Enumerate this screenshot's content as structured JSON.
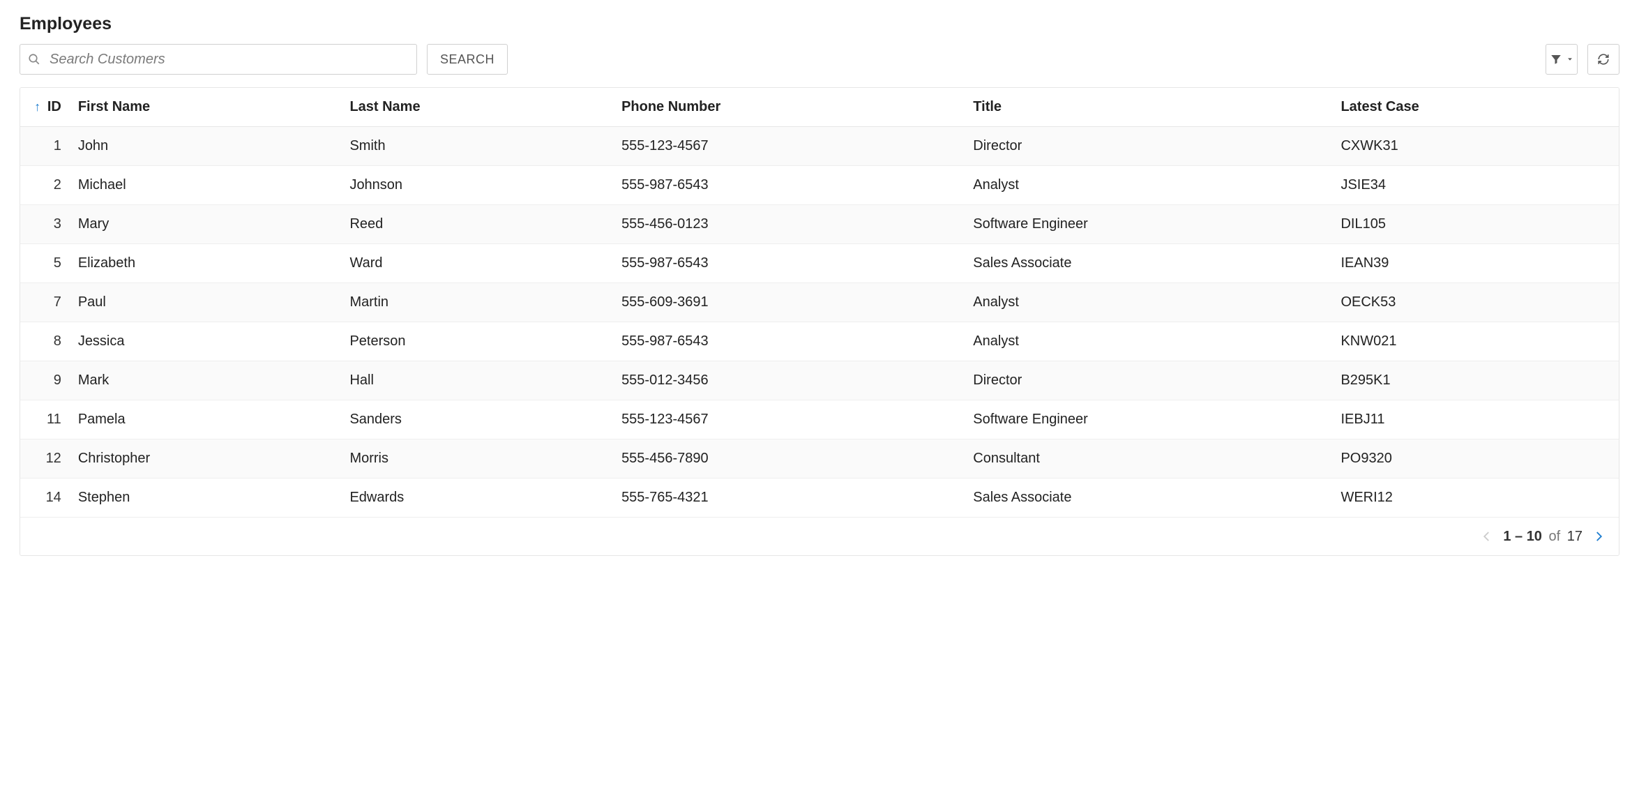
{
  "header": {
    "title": "Employees"
  },
  "toolbar": {
    "search_placeholder": "Search Customers",
    "search_value": "",
    "search_button_label": "SEARCH"
  },
  "table": {
    "sort_column": "ID",
    "sort_direction": "asc",
    "columns": [
      {
        "key": "id",
        "label": "ID"
      },
      {
        "key": "first_name",
        "label": "First Name"
      },
      {
        "key": "last_name",
        "label": "Last Name"
      },
      {
        "key": "phone",
        "label": "Phone Number"
      },
      {
        "key": "title",
        "label": "Title"
      },
      {
        "key": "latest_case",
        "label": "Latest Case"
      }
    ],
    "rows": [
      {
        "id": "1",
        "first_name": "John",
        "last_name": "Smith",
        "phone": "555-123-4567",
        "title": "Director",
        "latest_case": "CXWK31"
      },
      {
        "id": "2",
        "first_name": "Michael",
        "last_name": "Johnson",
        "phone": "555-987-6543",
        "title": "Analyst",
        "latest_case": "JSIE34"
      },
      {
        "id": "3",
        "first_name": "Mary",
        "last_name": "Reed",
        "phone": "555-456-0123",
        "title": "Software Engineer",
        "latest_case": "DIL105"
      },
      {
        "id": "5",
        "first_name": "Elizabeth",
        "last_name": "Ward",
        "phone": "555-987-6543",
        "title": "Sales Associate",
        "latest_case": "IEAN39"
      },
      {
        "id": "7",
        "first_name": "Paul",
        "last_name": "Martin",
        "phone": "555-609-3691",
        "title": "Analyst",
        "latest_case": "OECK53"
      },
      {
        "id": "8",
        "first_name": "Jessica",
        "last_name": "Peterson",
        "phone": "555-987-6543",
        "title": "Analyst",
        "latest_case": "KNW021"
      },
      {
        "id": "9",
        "first_name": "Mark",
        "last_name": "Hall",
        "phone": "555-012-3456",
        "title": "Director",
        "latest_case": "B295K1"
      },
      {
        "id": "11",
        "first_name": "Pamela",
        "last_name": "Sanders",
        "phone": "555-123-4567",
        "title": "Software Engineer",
        "latest_case": "IEBJ11"
      },
      {
        "id": "12",
        "first_name": "Christopher",
        "last_name": "Morris",
        "phone": "555-456-7890",
        "title": "Consultant",
        "latest_case": "PO9320"
      },
      {
        "id": "14",
        "first_name": "Stephen",
        "last_name": "Edwards",
        "phone": "555-765-4321",
        "title": "Sales Associate",
        "latest_case": "WERI12"
      }
    ]
  },
  "pagination": {
    "range": "1 – 10",
    "of_label": "of",
    "total": "17",
    "prev_enabled": false,
    "next_enabled": true
  }
}
